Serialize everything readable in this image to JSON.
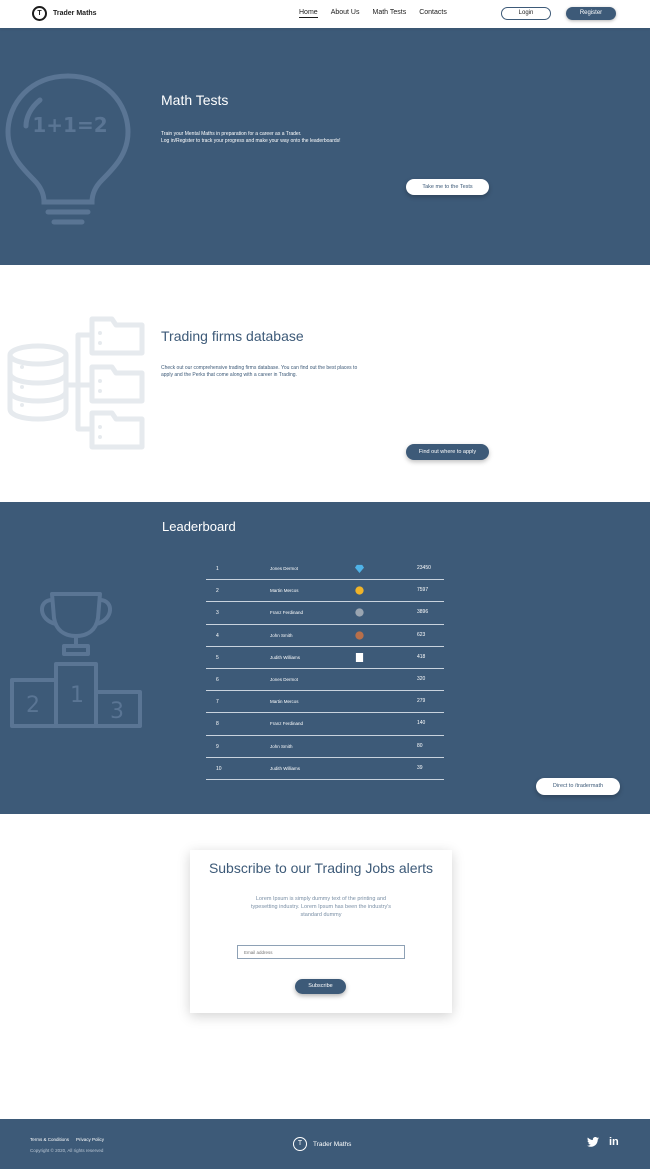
{
  "nav": {
    "logo_letter": "T",
    "brand": "Trader Maths",
    "links": [
      "Home",
      "About Us",
      "Math Tests",
      "Contacts"
    ],
    "login": "Login",
    "register": "Register"
  },
  "math_tests": {
    "title": "Math Tests",
    "line1": "Train your Mental Maths in preparation for a career as a Trader.",
    "line2": "Log in/Register to track your progress and make your way onto the leaderboards!",
    "button": "Take me to the Tests",
    "bulb_text": "1+1=2"
  },
  "firms": {
    "title": "Trading firms database",
    "line1": "Check out our comprehensive trading firms database. You can find out the best places to",
    "line2": "apply and the Perks that come along with a career in Trading.",
    "button": "Find out where to apply"
  },
  "leaderboard": {
    "title": "Leaderboard",
    "podium": [
      "2",
      "1",
      "3"
    ],
    "rows": [
      {
        "rank": "1",
        "name": "Jones Dermot",
        "score": "23450",
        "badge": "diamond"
      },
      {
        "rank": "2",
        "name": "Martin Mercos",
        "score": "7597",
        "badge": "gold"
      },
      {
        "rank": "3",
        "name": "Franz Ferdinand",
        "score": "3896",
        "badge": "silver"
      },
      {
        "rank": "4",
        "name": "John Smith",
        "score": "623",
        "badge": "bronze"
      },
      {
        "rank": "5",
        "name": "Judith Williams",
        "score": "418",
        "badge": "paper"
      },
      {
        "rank": "6",
        "name": "Jones Dermot",
        "score": "320",
        "badge": ""
      },
      {
        "rank": "7",
        "name": "Martin Mercos",
        "score": "279",
        "badge": ""
      },
      {
        "rank": "8",
        "name": "Franz Ferdinand",
        "score": "140",
        "badge": ""
      },
      {
        "rank": "9",
        "name": "John Smith",
        "score": "80",
        "badge": ""
      },
      {
        "rank": "10",
        "name": "Judith Williams",
        "score": "39",
        "badge": ""
      }
    ],
    "button": "Direct to /tradermath"
  },
  "subscribe": {
    "title": "Subscribe to our Trading Jobs alerts",
    "line1": "Lorem Ipsum is simply dummy text of the printing and",
    "line2": "typesetting industry. Lorem Ipsum has been the industry's",
    "line3": "standard dummy",
    "placeholder": "Email address",
    "button": "Subscribe"
  },
  "footer": {
    "terms": "Terms & Conditions",
    "privacy": "Privacy Policy",
    "copyright": "Copyright © 2020, All rights reserved",
    "logo_letter": "T",
    "brand": "Trader Maths",
    "linkedin": "in"
  },
  "colors": {
    "primary": "#3d5a78",
    "white": "#ffffff",
    "gold": "#f0b429",
    "silver": "#9aa5b1",
    "bronze": "#b86f4a",
    "diamond": "#4fb3e8"
  }
}
